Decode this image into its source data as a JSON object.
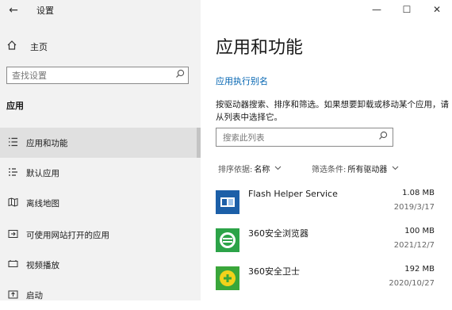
{
  "window": {
    "title": "设置",
    "back_icon": "back-arrow-icon",
    "controls": {
      "minimize": "—",
      "maximize": "☐",
      "close": "✕"
    }
  },
  "sidebar": {
    "home_label": "主页",
    "search_placeholder": "查找设置",
    "section_title": "应用",
    "items": [
      {
        "label": "应用和功能",
        "icon": "apps-list-icon",
        "selected": true
      },
      {
        "label": "默认应用",
        "icon": "default-apps-icon",
        "selected": false
      },
      {
        "label": "离线地图",
        "icon": "map-icon",
        "selected": false
      },
      {
        "label": "可使用网站打开的应用",
        "icon": "web-app-icon",
        "selected": false
      },
      {
        "label": "视频播放",
        "icon": "video-icon",
        "selected": false
      },
      {
        "label": "启动",
        "icon": "startup-icon",
        "selected": false
      }
    ]
  },
  "main": {
    "title": "应用和功能",
    "alias_link": "应用执行别名",
    "description": "按驱动器搜索、排序和筛选。如果想要卸载或移动某个应用，请从列表中选择它。",
    "search_placeholder": "搜索此列表",
    "sort_label": "排序依据:",
    "sort_value": "名称",
    "filter_label": "筛选条件:",
    "filter_value": "所有驱动器",
    "apps": [
      {
        "name": "Flash Helper Service",
        "size": "1.08 MB",
        "date": "2019/3/17",
        "icon": "flash-helper-icon"
      },
      {
        "name": "360安全浏览器",
        "size": "100 MB",
        "date": "2021/12/7",
        "icon": "360-browser-icon"
      },
      {
        "name": "360安全卫士",
        "size": "192 MB",
        "date": "2020/10/27",
        "icon": "360-safe-icon"
      }
    ]
  },
  "colors": {
    "accent": "#0063b1",
    "sidebar_bg": "#f2f2f2",
    "selected_bg": "#e0e0e0",
    "flash_icon_bg": "#1c5fa8",
    "browser_icon_bg": "#2ca348",
    "safe_icon_bg": "#3aa63a"
  }
}
